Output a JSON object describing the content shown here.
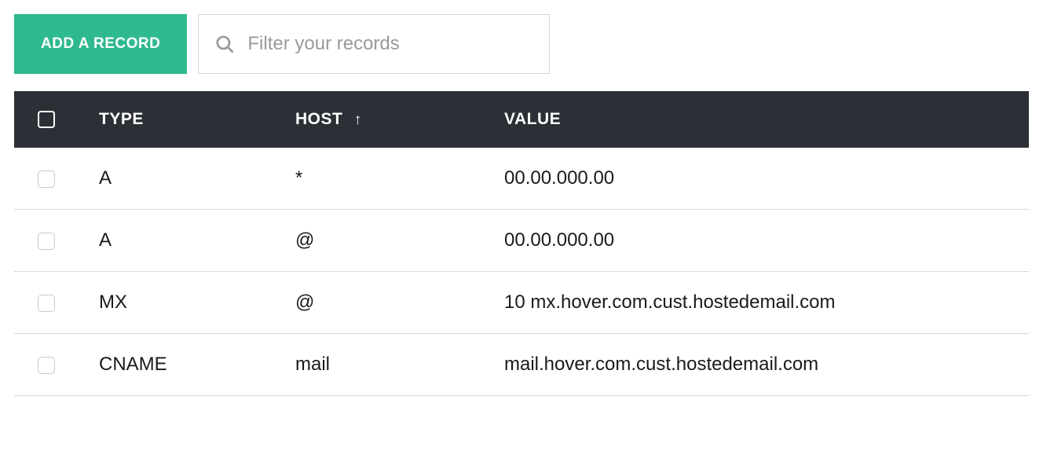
{
  "toolbar": {
    "add_label": "ADD A RECORD",
    "filter_placeholder": "Filter your records"
  },
  "table": {
    "headers": {
      "type": "TYPE",
      "host": "HOST",
      "value": "VALUE"
    },
    "sort_indicator": "↑",
    "rows": [
      {
        "type": "A",
        "host": "*",
        "value": "00.00.000.00"
      },
      {
        "type": "A",
        "host": "@",
        "value": "00.00.000.00"
      },
      {
        "type": "MX",
        "host": "@",
        "value": "10 mx.hover.com.cust.hostedemail.com"
      },
      {
        "type": "CNAME",
        "host": "mail",
        "value": "mail.hover.com.cust.hostedemail.com"
      }
    ]
  },
  "colors": {
    "accent": "#2fb98f",
    "header_bg": "#2c3036"
  }
}
